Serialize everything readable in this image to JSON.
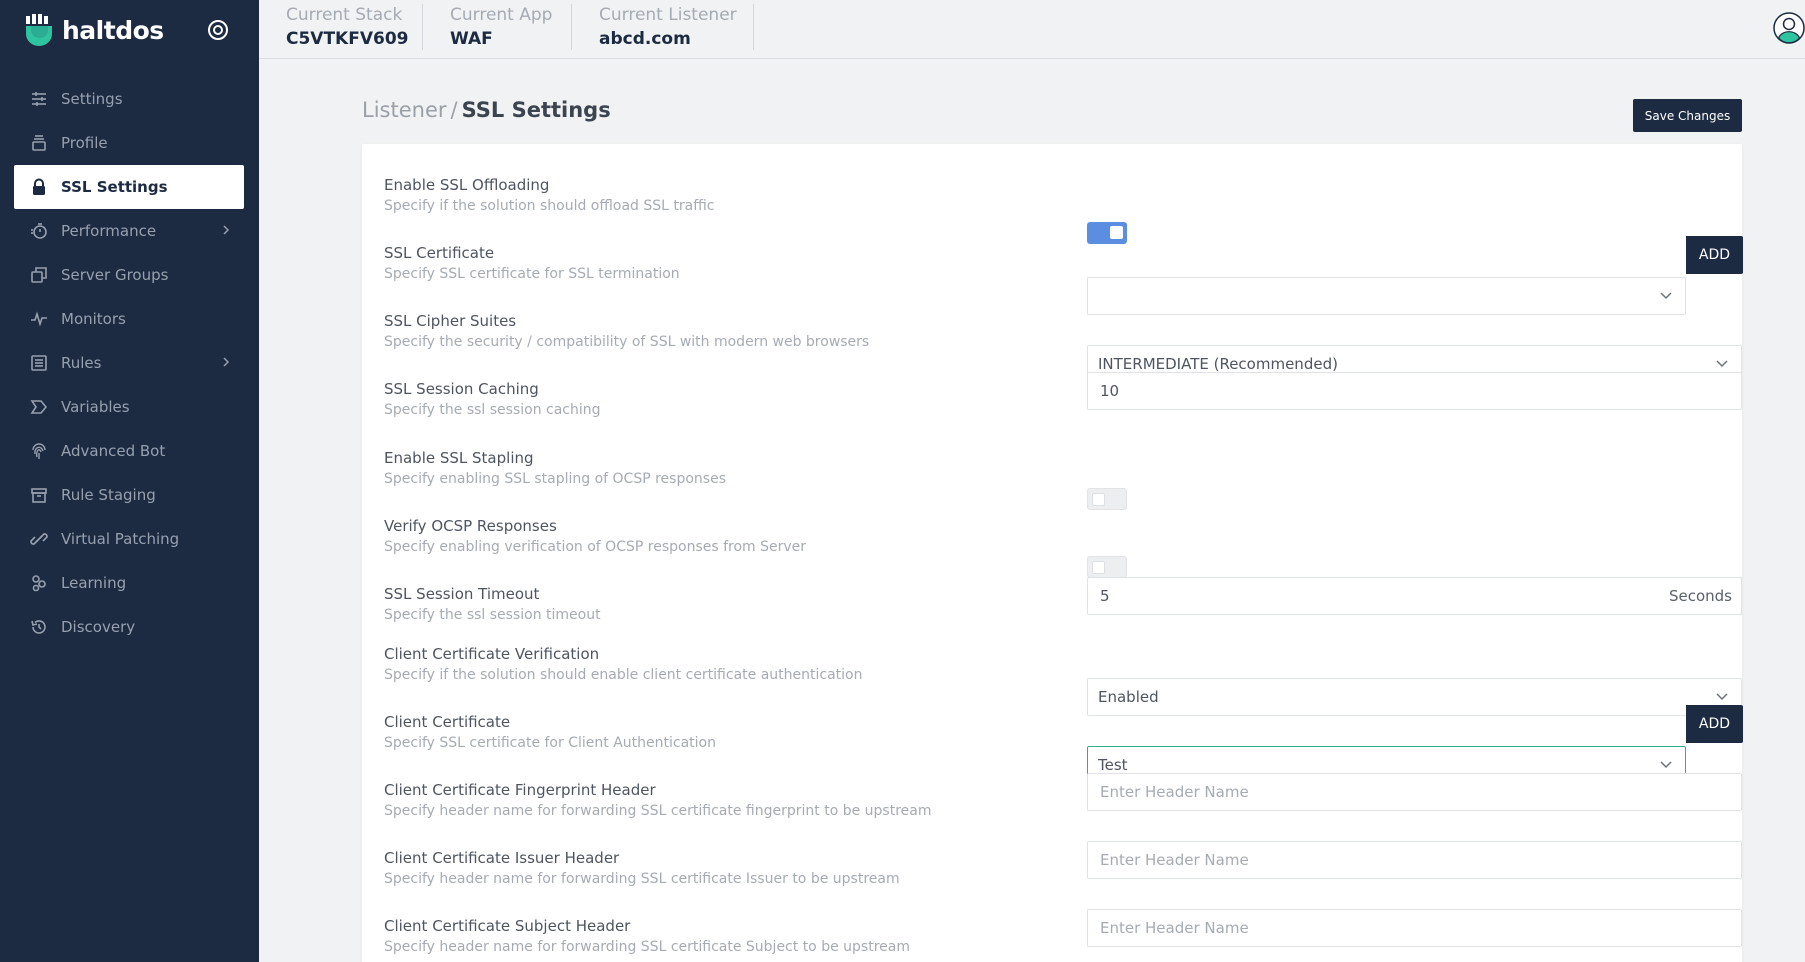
{
  "brand": {
    "name": "haltdos"
  },
  "sidebar": {
    "items": [
      {
        "label": "Settings",
        "icon": "sliders-icon",
        "active": false,
        "has_children": false
      },
      {
        "label": "Profile",
        "icon": "profile-stack-icon",
        "active": false,
        "has_children": false
      },
      {
        "label": "SSL Settings",
        "icon": "lock-icon",
        "active": true,
        "has_children": false
      },
      {
        "label": "Performance",
        "icon": "stopwatch-icon",
        "active": false,
        "has_children": true
      },
      {
        "label": "Server Groups",
        "icon": "copy-icon",
        "active": false,
        "has_children": false
      },
      {
        "label": "Monitors",
        "icon": "pulse-icon",
        "active": false,
        "has_children": false
      },
      {
        "label": "Rules",
        "icon": "list-icon",
        "active": false,
        "has_children": true
      },
      {
        "label": "Variables",
        "icon": "tag-icon",
        "active": false,
        "has_children": false
      },
      {
        "label": "Advanced Bot",
        "icon": "fingerprint-icon",
        "active": false,
        "has_children": false
      },
      {
        "label": "Rule Staging",
        "icon": "archive-icon",
        "active": false,
        "has_children": false
      },
      {
        "label": "Virtual Patching",
        "icon": "link-icon",
        "active": false,
        "has_children": false
      },
      {
        "label": "Learning",
        "icon": "nodes-icon",
        "active": false,
        "has_children": false
      },
      {
        "label": "Discovery",
        "icon": "history-icon",
        "active": false,
        "has_children": false
      }
    ]
  },
  "topbar": {
    "stack_label": "Current Stack",
    "stack_value": "C5VTKFV609",
    "app_label": "Current App",
    "app_value": "WAF",
    "listener_label": "Current Listener",
    "listener_value": "abcd.com"
  },
  "page": {
    "breadcrumb_root": "Listener",
    "breadcrumb_sep": "/",
    "title": "SSL Settings",
    "save_label": "Save Changes"
  },
  "settings": {
    "offloading": {
      "title": "Enable SSL Offloading",
      "desc": "Specify if the solution should offload SSL traffic",
      "enabled": true
    },
    "certificate": {
      "title": "SSL Certificate",
      "desc": "Specify SSL certificate for SSL termination",
      "value": "",
      "add_label": "ADD"
    },
    "cipher": {
      "title": "SSL Cipher Suites",
      "desc": "Specify the security / compatibility of SSL with modern web browsers",
      "value": "INTERMEDIATE (Recommended)"
    },
    "caching": {
      "title": "SSL Session Caching",
      "desc": "Specify the ssl session caching",
      "value": "10"
    },
    "stapling": {
      "title": "Enable SSL Stapling",
      "desc": "Specify enabling SSL stapling of OCSP responses",
      "enabled": false
    },
    "ocsp": {
      "title": "Verify OCSP Responses",
      "desc": "Specify enabling verification of OCSP responses from Server",
      "enabled": false
    },
    "timeout": {
      "title": "SSL Session Timeout",
      "desc": "Specify the ssl session timeout",
      "value": "5",
      "unit": "Seconds"
    },
    "client_verify": {
      "title": "Client Certificate Verification",
      "desc": "Specify if the solution should enable client certificate authentication",
      "value": "Enabled"
    },
    "client_cert": {
      "title": "Client Certificate",
      "desc": "Specify SSL certificate for Client Authentication",
      "value": "Test",
      "add_label": "ADD"
    },
    "fingerprint_header": {
      "title": "Client Certificate Fingerprint Header",
      "desc": "Specify header name for forwarding SSL certificate fingerprint to be upstream",
      "value": "",
      "placeholder": "Enter Header Name"
    },
    "issuer_header": {
      "title": "Client Certificate Issuer Header",
      "desc": "Specify header name for forwarding SSL certificate Issuer to be upstream",
      "value": "",
      "placeholder": "Enter Header Name"
    },
    "subject_header": {
      "title": "Client Certificate Subject Header",
      "desc": "Specify header name for forwarding SSL certificate Subject to be upstream",
      "value": "",
      "placeholder": "Enter Header Name"
    }
  },
  "colors": {
    "sidebar_bg": "#1c2a42",
    "accent": "#5b8de0",
    "focus": "#2fae8c"
  }
}
